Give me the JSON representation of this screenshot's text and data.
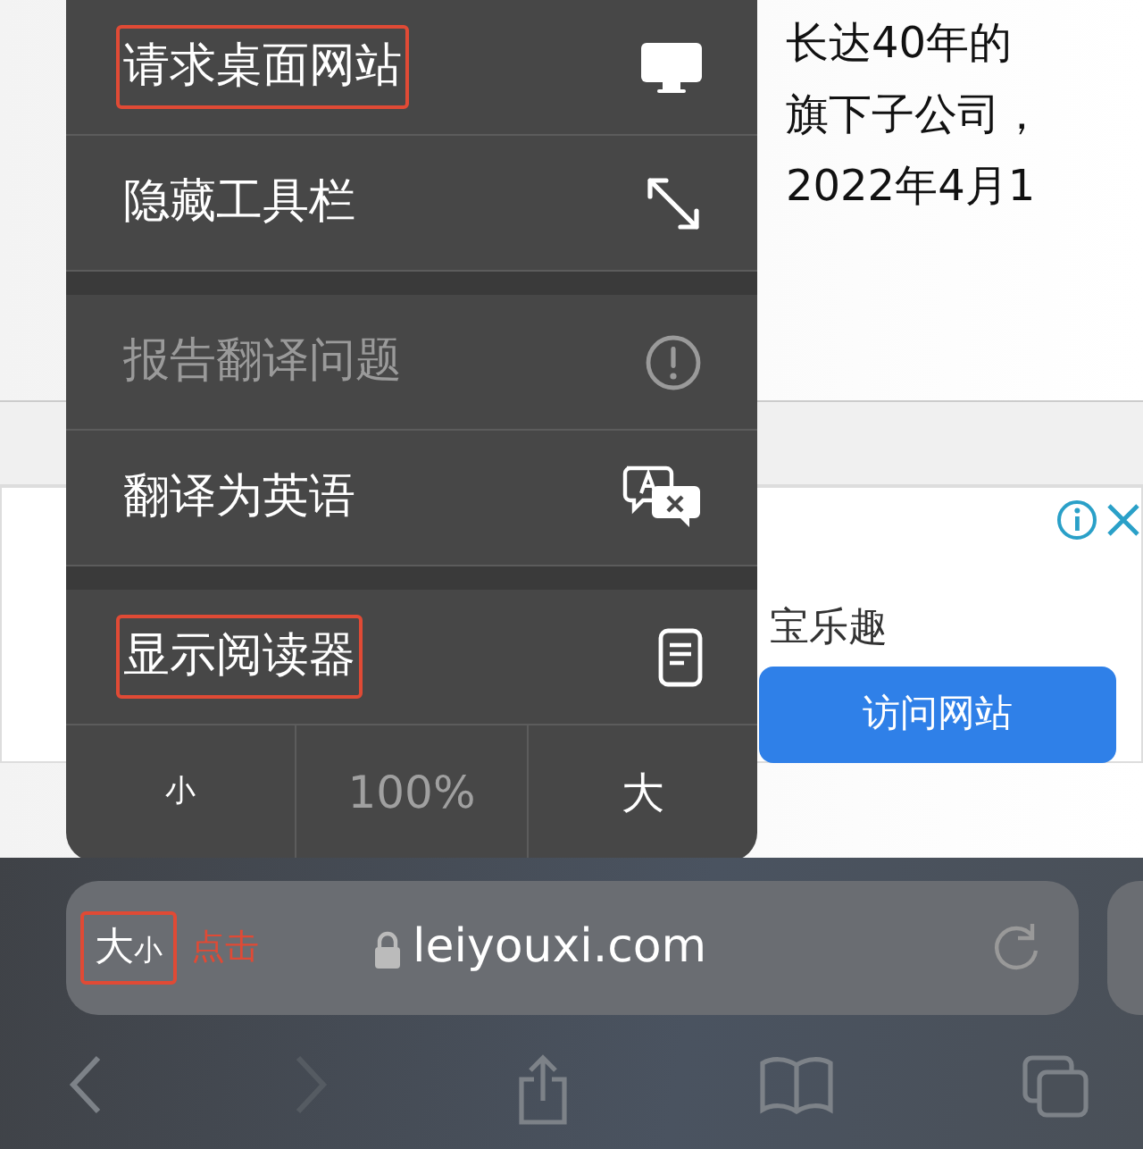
{
  "article": {
    "lines": [
      "长达40年的",
      "旗下子公司，",
      "2022年4月1"
    ]
  },
  "ad": {
    "lines": [
      "宝乐趣"
    ],
    "button": "访问网站"
  },
  "menu": {
    "groups": [
      [
        {
          "label": "请求桌面网站",
          "disabled": false,
          "annotated": true
        },
        {
          "label": "隐藏工具栏",
          "disabled": false,
          "annotated": false
        }
      ],
      [
        {
          "label": "报告翻译问题",
          "disabled": true,
          "annotated": false
        },
        {
          "label": "翻译为英语",
          "disabled": false,
          "annotated": false
        }
      ],
      [
        {
          "label": "显示阅读器",
          "disabled": false,
          "annotated": true
        }
      ]
    ],
    "zoom": {
      "smaller": "小",
      "percent": "100%",
      "larger": "大"
    }
  },
  "address_bar": {
    "text_size_button": {
      "big": "大",
      "small": "小",
      "annotated": true
    },
    "annotation": "点击",
    "url": "leiyouxi.com"
  },
  "toolbar": [
    {
      "disabled": false
    },
    {
      "disabled": true
    },
    {
      "disabled": false
    },
    {
      "disabled": false
    },
    {
      "disabled": false
    }
  ]
}
